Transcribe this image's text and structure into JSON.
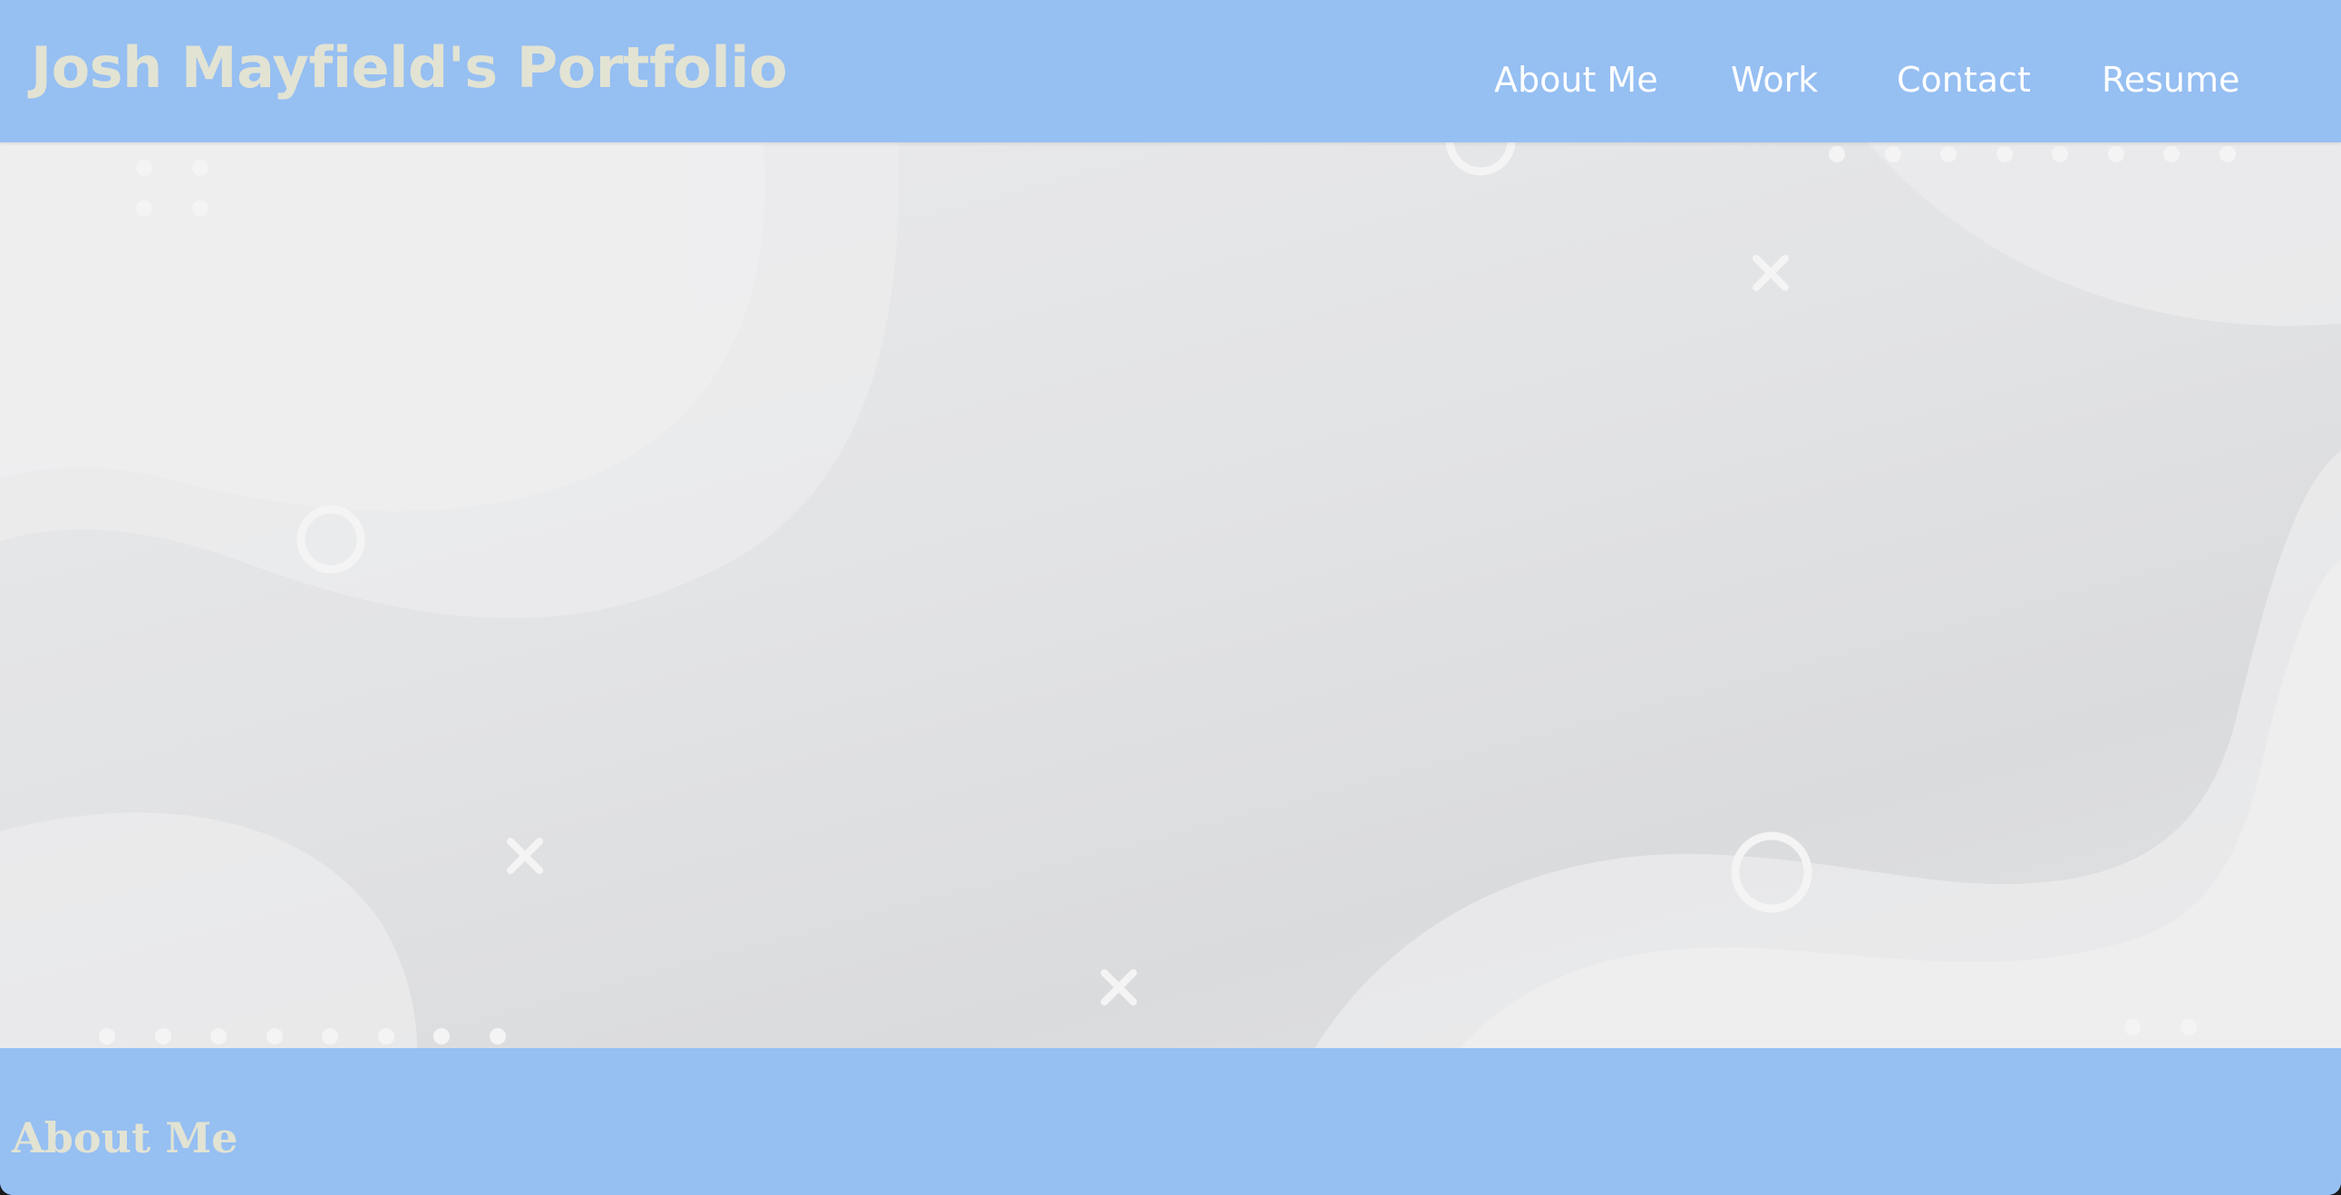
{
  "header": {
    "title": "Josh Mayfield's Portfolio",
    "nav": [
      "About Me",
      "Work",
      "Contact",
      "Resume"
    ]
  },
  "hero": {
    "decorations": [
      "circle-ring",
      "x-mark",
      "dot-row",
      "wave-shape"
    ]
  },
  "about": {
    "heading": "About Me"
  },
  "colors": {
    "header_bg": "#96bff2",
    "title_text": "#e2e3d3",
    "nav_text": "#ffffff",
    "hero_bg": "#e2e3e5",
    "decoration": "#f2f2f3"
  }
}
